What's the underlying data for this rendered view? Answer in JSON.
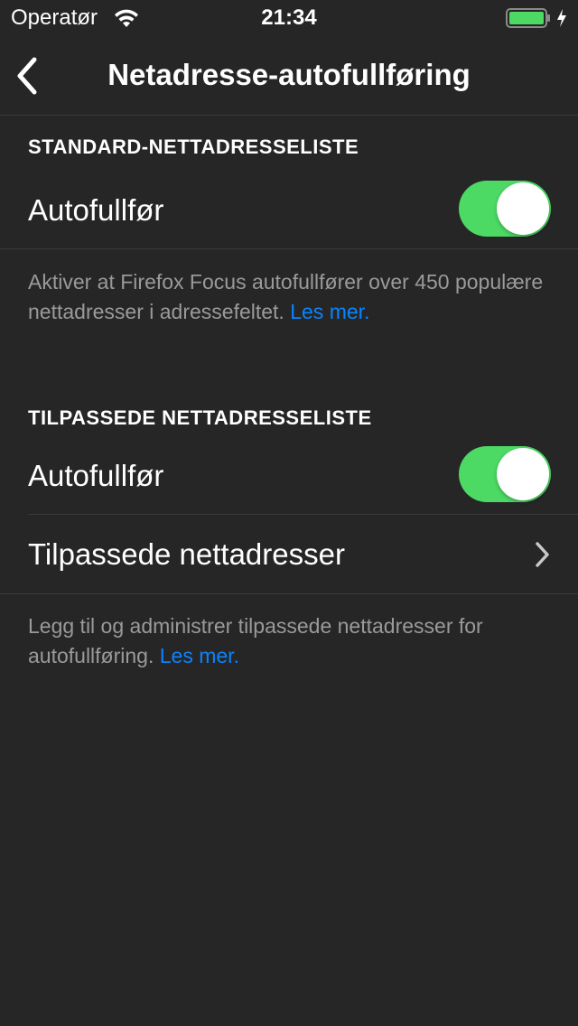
{
  "status_bar": {
    "carrier": "Operatør",
    "time": "21:34",
    "wifi_icon": "wifi-icon",
    "battery_icon": "battery-icon",
    "charging_icon": "charging-bolt-icon",
    "battery_color": "#4cd964"
  },
  "nav": {
    "back_icon": "chevron-left-icon",
    "title": "Netadresse-autofullføring"
  },
  "sections": [
    {
      "header": "STANDARD-NETTADRESSELISTE",
      "rows": [
        {
          "label": "Autofullfør",
          "toggle_on": true
        }
      ],
      "footer": "Aktiver at Firefox Focus autofullfører over 450 populære nettadresser i adressefeltet.",
      "footer_link": "Les mer."
    },
    {
      "header": "TILPASSEDE NETTADRESSELISTE",
      "rows": [
        {
          "label": "Autofullfør",
          "toggle_on": true
        },
        {
          "label": "Tilpassede nettadresser",
          "icon": "chevron-right-icon"
        }
      ],
      "footer": "Legg til og administrer tilpassede nettadresser for autofullføring.",
      "footer_link": "Les mer."
    }
  ],
  "colors": {
    "background": "#262626",
    "toggle_on": "#4cd964",
    "link": "#0a84ff",
    "footer_text": "#9a9a9a"
  }
}
